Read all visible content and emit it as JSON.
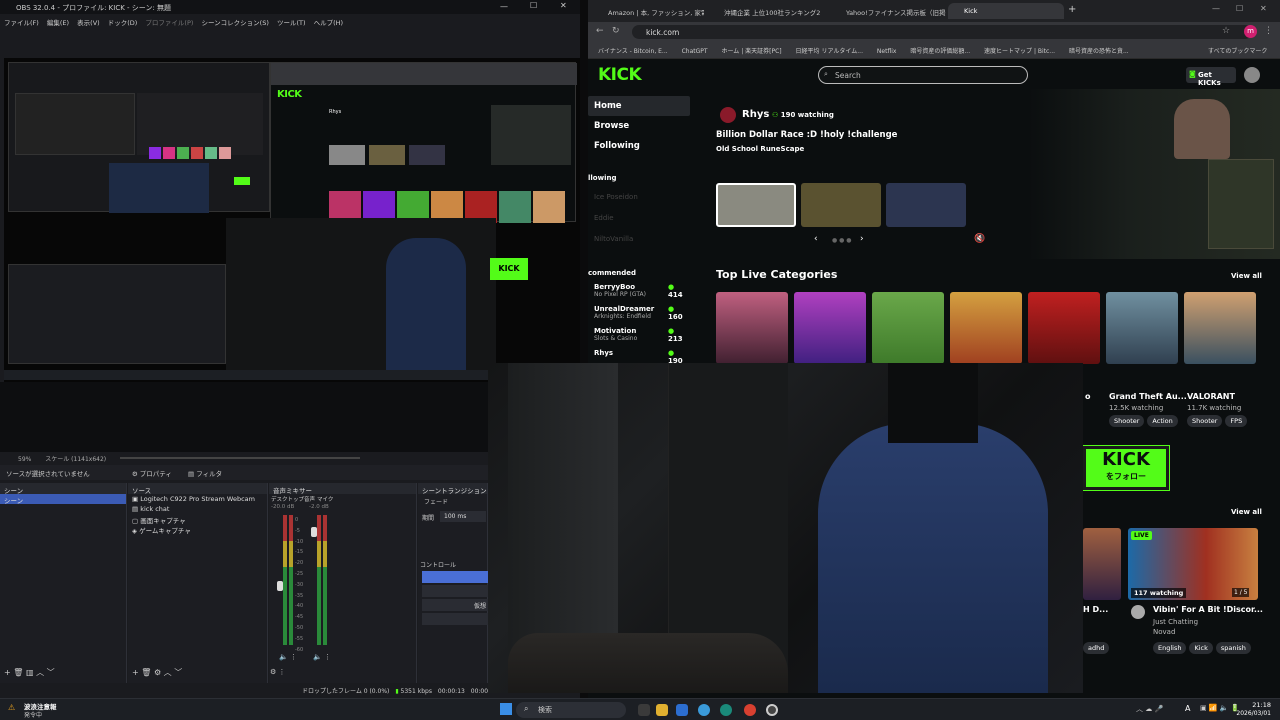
{
  "obs": {
    "title": "OBS 32.0.4 - プロファイル: KICK - シーン: 無題",
    "menu": [
      "ファイル(F)",
      "編集(E)",
      "表示(V)",
      "ドック(D)",
      "プロファイル(P)",
      "シーンコレクション(S)",
      "ツール(T)",
      "ヘルプ(H)"
    ],
    "zoom": "59%",
    "scale": "スケール (1141x642)",
    "no_source": "ソースが選択されていません",
    "props_btn": "プロパティ",
    "filter_btn": "フィルタ",
    "scenes_header": "シーン",
    "scenes": [
      "シーン"
    ],
    "sources_header": "ソース",
    "sources": [
      "Logitech C922 Pro Stream Webcam",
      "kick chat",
      "画面キャプチャ",
      "ゲームキャプチャ"
    ],
    "mixer_header": "音声ミキサー",
    "mixer_desktop": "デスクトップ音声",
    "mixer_mic": "マイク",
    "mixer_db1": "-20.0 dB",
    "mixer_db2": "-2.0 dB",
    "mixer_scale": [
      "0",
      "-5",
      "-10",
      "-15",
      "-20",
      "-25",
      "-30",
      "-35",
      "-40",
      "-45",
      "-50",
      "-55",
      "-60"
    ],
    "transitions_header": "シーントランジション",
    "transition": "フェード",
    "duration_label": "期間",
    "duration": "100 ms",
    "controls_header": "コントロール",
    "controls_partial": "仮想",
    "status_dropped": "ドロップしたフレーム 0 (0.0%)",
    "status_kbps": "5351 kbps",
    "status_time": "00:00:13",
    "status_time2": "00:00:0"
  },
  "browser": {
    "tabs": [
      "Amazon | 本, ファッション, 家電から",
      "沖縄企業 上位100社ランキング2",
      "Yahoo!ファイナンス掲示板（旧掲示",
      "Kick"
    ],
    "url": "kick.com",
    "bookmarks": [
      "バイナンス - Bitcoin, E...",
      "ChatGPT",
      "ホーム | 楽天証券[PC]",
      "日経平均 リアルタイム...",
      "Netflix",
      "暗号資産の評価総額...",
      "速度ヒートマップ | Bitc...",
      "暗号資産の恐怖と貪..."
    ],
    "bookmarks_all": "すべてのブックマーク",
    "avatar_letter": "m"
  },
  "kick": {
    "logo": "KICK",
    "search_placeholder": "Search",
    "get_kicks": "Get KICKs",
    "nav": [
      "Home",
      "Browse",
      "Following"
    ],
    "following_label": "llowing",
    "following_channels": [
      "Ice Poseidon",
      "Eddie",
      "NiltoVanilla"
    ],
    "recommended_label": "commended",
    "recommended": [
      {
        "name": "BerryyBoo",
        "sub": "No Pixel RP (GTA)",
        "viewers": "414"
      },
      {
        "name": "UnrealDreamer",
        "sub": "Arknights: Endfield",
        "viewers": "160"
      },
      {
        "name": "Motivation",
        "sub": "Slots & Casino",
        "viewers": "213"
      },
      {
        "name": "Rhys",
        "sub": "",
        "viewers": "190"
      }
    ],
    "featured": {
      "streamer": "Rhys",
      "watching": "190 watching",
      "title": "Billion Dollar Race :D !holy !challenge",
      "category": "Old School RuneScape"
    },
    "top_categories": "Top Live Categories",
    "view_all": "View all",
    "categories": [
      {
        "name": "",
        "viewers": "",
        "tags": []
      },
      {
        "name": "",
        "viewers": "",
        "tags": []
      },
      {
        "name": "",
        "viewers": "",
        "tags": []
      },
      {
        "name": "",
        "viewers": "",
        "tags": []
      },
      {
        "name": "o",
        "viewers": "",
        "tags": []
      },
      {
        "name": "Grand Theft Au...",
        "viewers": "12.5K watching",
        "tags": [
          "Shooter",
          "Action"
        ]
      },
      {
        "name": "VALORANT",
        "viewers": "11.7K watching",
        "tags": [
          "Shooter",
          "FPS"
        ]
      }
    ],
    "follow_banner": "KICK",
    "follow_banner_sub": "をフォロー",
    "view_all_2": "View all",
    "live_badge": "LIVE",
    "stream_card": {
      "watching": "117 watching",
      "title": "Vibin' For A Bit !Discor...",
      "category": "Just Chatting",
      "streamer": "Novad",
      "tags": [
        "English",
        "Kick",
        "spanish"
      ],
      "page": "1 / 5"
    },
    "partial_card": {
      "title": "H D...",
      "tag": "adhd"
    }
  },
  "taskbar": {
    "weather_title": "波浪注意報",
    "weather_sub": "発令中",
    "search": "検索",
    "time": "21:18",
    "date": "2026/03/01",
    "ime": "A"
  },
  "colors": {
    "kick_green": "#53fc18",
    "obs_bg": "#1a1b1f",
    "accent": "#3b5bb5"
  }
}
